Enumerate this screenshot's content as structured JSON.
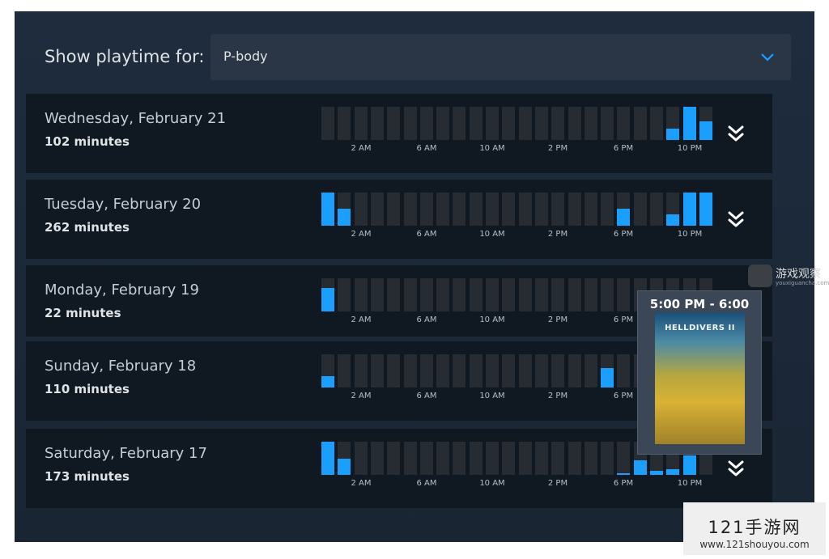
{
  "header": {
    "label": "Show playtime for:",
    "selected_account": "P-body"
  },
  "time_axis": [
    "2 AM",
    "6 AM",
    "10 AM",
    "2 PM",
    "6 PM",
    "10 PM"
  ],
  "days": [
    {
      "title": "Wednesday, February 21",
      "minutes": "102 minutes",
      "hourly_fraction": [
        0,
        0,
        0,
        0,
        0,
        0,
        0,
        0,
        0,
        0,
        0,
        0,
        0,
        0,
        0,
        0,
        0,
        0,
        0,
        0,
        0,
        0.33,
        1.0,
        0.55
      ]
    },
    {
      "title": "Tuesday, February 20",
      "minutes": "262 minutes",
      "hourly_fraction": [
        1.0,
        0.52,
        0,
        0,
        0,
        0,
        0,
        0,
        0,
        0,
        0,
        0,
        0,
        0,
        0,
        0,
        0,
        0,
        0.52,
        0,
        0,
        0.33,
        1.0,
        1.0
      ]
    },
    {
      "title": "Monday, February 19",
      "minutes": "22 minutes",
      "hourly_fraction": [
        0.7,
        0,
        0,
        0,
        0,
        0,
        0,
        0,
        0,
        0,
        0,
        0,
        0,
        0,
        0,
        0,
        0,
        0,
        0,
        0,
        0,
        0,
        0,
        0
      ]
    },
    {
      "title": "Sunday, February 18",
      "minutes": "110 minutes",
      "hourly_fraction": [
        0.33,
        0,
        0,
        0,
        0,
        0,
        0,
        0,
        0,
        0,
        0,
        0,
        0,
        0,
        0,
        0,
        0,
        0.58,
        0,
        0,
        0,
        0,
        0,
        0
      ]
    },
    {
      "title": "Saturday, February 17",
      "minutes": "173 minutes",
      "hourly_fraction": [
        1.0,
        0.48,
        0,
        0,
        0,
        0,
        0,
        0,
        0,
        0,
        0,
        0,
        0,
        0,
        0,
        0,
        0,
        0,
        0.05,
        0.45,
        0.12,
        0.17,
        0.58,
        0
      ]
    }
  ],
  "tooltip": {
    "time_range": "5:00 PM - 6:00 PM",
    "game_logo": "HELLDIVERS II"
  },
  "colors": {
    "bar_fill": "#1a9fff",
    "bar_empty": "#272c33",
    "row_bg": "#101822",
    "panel_bg": "#1b2838"
  },
  "watermarks": {
    "site1_name": "游戏观察",
    "site1_url": "youxiguancha.com",
    "site2_name": "121手游网",
    "site2_url": "www.121shouyou.com"
  }
}
